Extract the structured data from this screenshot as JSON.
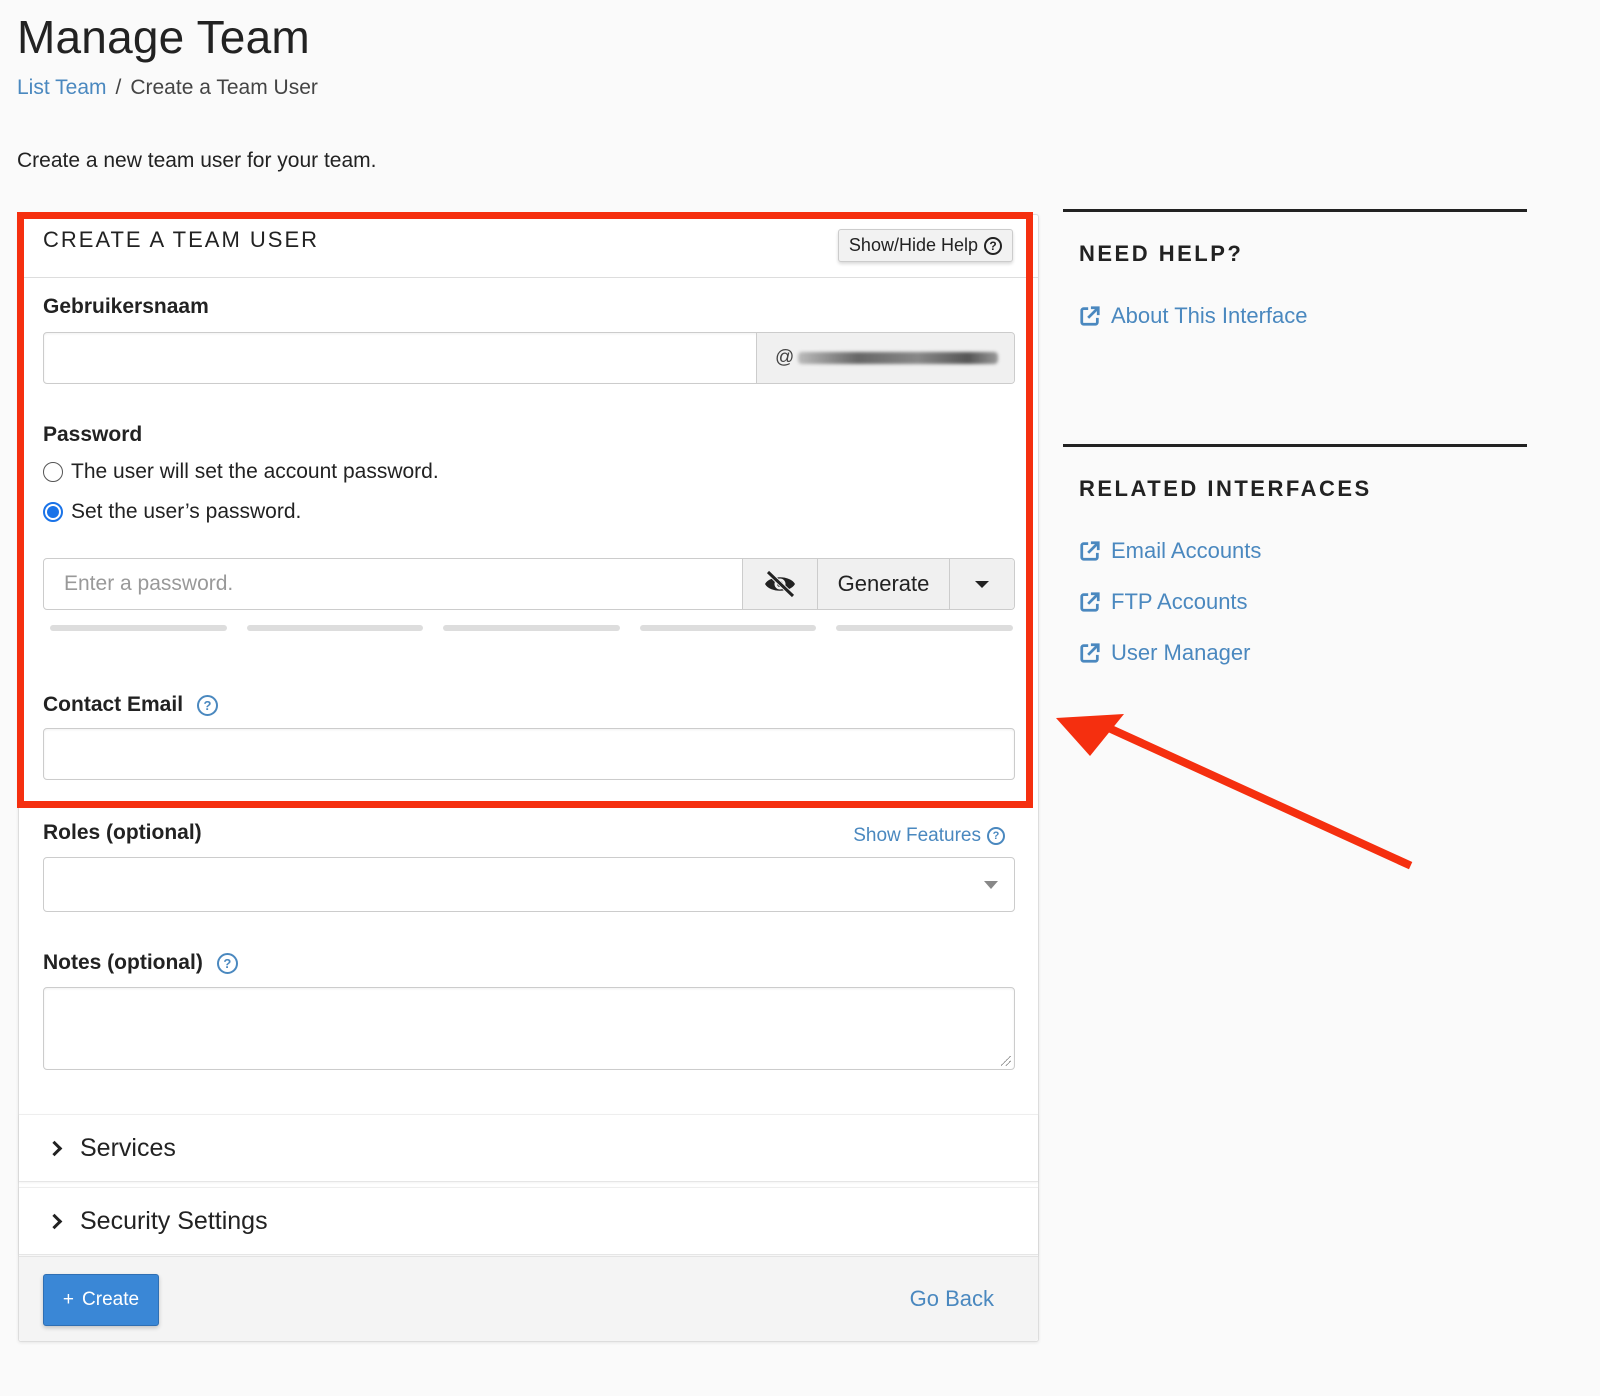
{
  "page": {
    "title": "Manage Team",
    "breadcrumb": {
      "parent": "List Team",
      "separator": "/",
      "current": "Create a Team User"
    },
    "intro": "Create a new team user for your team."
  },
  "form": {
    "title": "CREATE A TEAM USER",
    "help_toggle": "Show/Hide Help",
    "username": {
      "label": "Gebruikersnaam",
      "value": "",
      "domain_prefix": "@"
    },
    "password": {
      "label": "Password",
      "options": [
        {
          "label": "The user will set the account password.",
          "checked": false
        },
        {
          "label": "Set the user’s password.",
          "checked": true
        }
      ],
      "placeholder": "Enter a password.",
      "generate_label": "Generate",
      "strength_segments": 5,
      "strength_filled": 0
    },
    "contact_email": {
      "label": "Contact Email",
      "value": ""
    },
    "roles": {
      "label": "Roles (optional)",
      "show_features": "Show Features",
      "selected": ""
    },
    "notes": {
      "label": "Notes (optional)",
      "value": ""
    },
    "accordions": [
      {
        "label": "Services",
        "expanded": false
      },
      {
        "label": "Security Settings",
        "expanded": false
      }
    ],
    "footer": {
      "create_label": "Create",
      "create_icon": "+",
      "go_back_label": "Go Back"
    }
  },
  "sidebar": {
    "need_help": {
      "title": "NEED HELP?",
      "links": [
        {
          "label": "About This Interface",
          "icon": "external-link-icon"
        }
      ]
    },
    "related": {
      "title": "RELATED INTERFACES",
      "links": [
        {
          "label": "Email Accounts",
          "icon": "external-link-icon"
        },
        {
          "label": "FTP Accounts",
          "icon": "external-link-icon"
        },
        {
          "label": "User Manager",
          "icon": "external-link-icon"
        }
      ]
    }
  },
  "colors": {
    "link": "#4a88bf",
    "primary_button": "#3a87d6",
    "annotation": "#f52f0f",
    "radio_checked": "#1a73e8"
  }
}
